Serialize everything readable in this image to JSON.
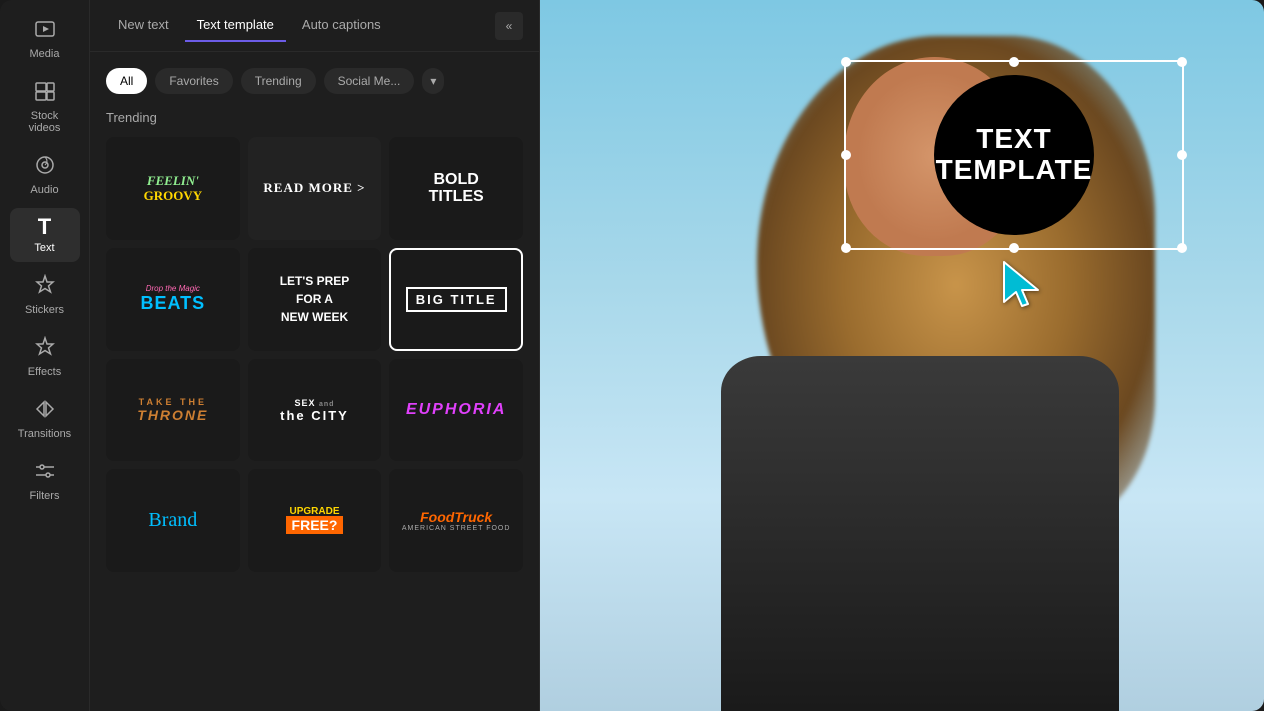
{
  "sidebar": {
    "items": [
      {
        "id": "media",
        "label": "Media",
        "icon": "⬛"
      },
      {
        "id": "stock-videos",
        "label": "Stock videos",
        "icon": "⊞"
      },
      {
        "id": "audio",
        "label": "Audio",
        "icon": "♪"
      },
      {
        "id": "text",
        "label": "Text",
        "icon": "T",
        "active": true
      },
      {
        "id": "stickers",
        "label": "Stickers",
        "icon": "✦"
      },
      {
        "id": "effects",
        "label": "Effects",
        "icon": "✦"
      },
      {
        "id": "transitions",
        "label": "Transitions",
        "icon": "⊠"
      },
      {
        "id": "filters",
        "label": "Filters",
        "icon": "⊟"
      }
    ]
  },
  "panel": {
    "tabs": [
      {
        "id": "new-text",
        "label": "New text",
        "active": false
      },
      {
        "id": "text-template",
        "label": "Text template",
        "active": true
      },
      {
        "id": "auto-captions",
        "label": "Auto captions",
        "active": false
      }
    ],
    "more_button_label": "«",
    "filter_chips": [
      {
        "id": "all",
        "label": "All",
        "active": true
      },
      {
        "id": "favorites",
        "label": "Favorites",
        "active": false
      },
      {
        "id": "trending",
        "label": "Trending",
        "active": false
      },
      {
        "id": "social-media",
        "label": "Social Me...",
        "active": false
      }
    ],
    "dropdown_icon": "▾",
    "section_title": "Trending",
    "templates": [
      {
        "id": "feelin-groovy",
        "line1": "FEELIN'",
        "line2": "GROOVY"
      },
      {
        "id": "read-more",
        "text": "READ MORE >"
      },
      {
        "id": "bold-titles",
        "line1": "BOLD",
        "line2": "TITLES"
      },
      {
        "id": "drop-beats",
        "top": "Drop the Magic",
        "bottom": "BEATS"
      },
      {
        "id": "lets-prep",
        "text": "LET'S PREP FOR A NEW WEEK"
      },
      {
        "id": "big-title",
        "text": "BIG TITLE"
      },
      {
        "id": "take-throne",
        "line1": "TAKE THE",
        "line2": "THRONE"
      },
      {
        "id": "sex-city",
        "text": "SEX AND THE CITY"
      },
      {
        "id": "euphoria",
        "text": "EUPHORIA"
      },
      {
        "id": "brand",
        "text": "Brand"
      },
      {
        "id": "upgrade-free",
        "line1": "UPGRADE",
        "line2": "FREE?"
      },
      {
        "id": "food-truck",
        "line1": "FoodTruck",
        "line2": "AMERICAN STREET FOOD"
      }
    ]
  },
  "canvas": {
    "text_template": {
      "line1": "TEXT",
      "line2": "TEMPLATE"
    }
  }
}
